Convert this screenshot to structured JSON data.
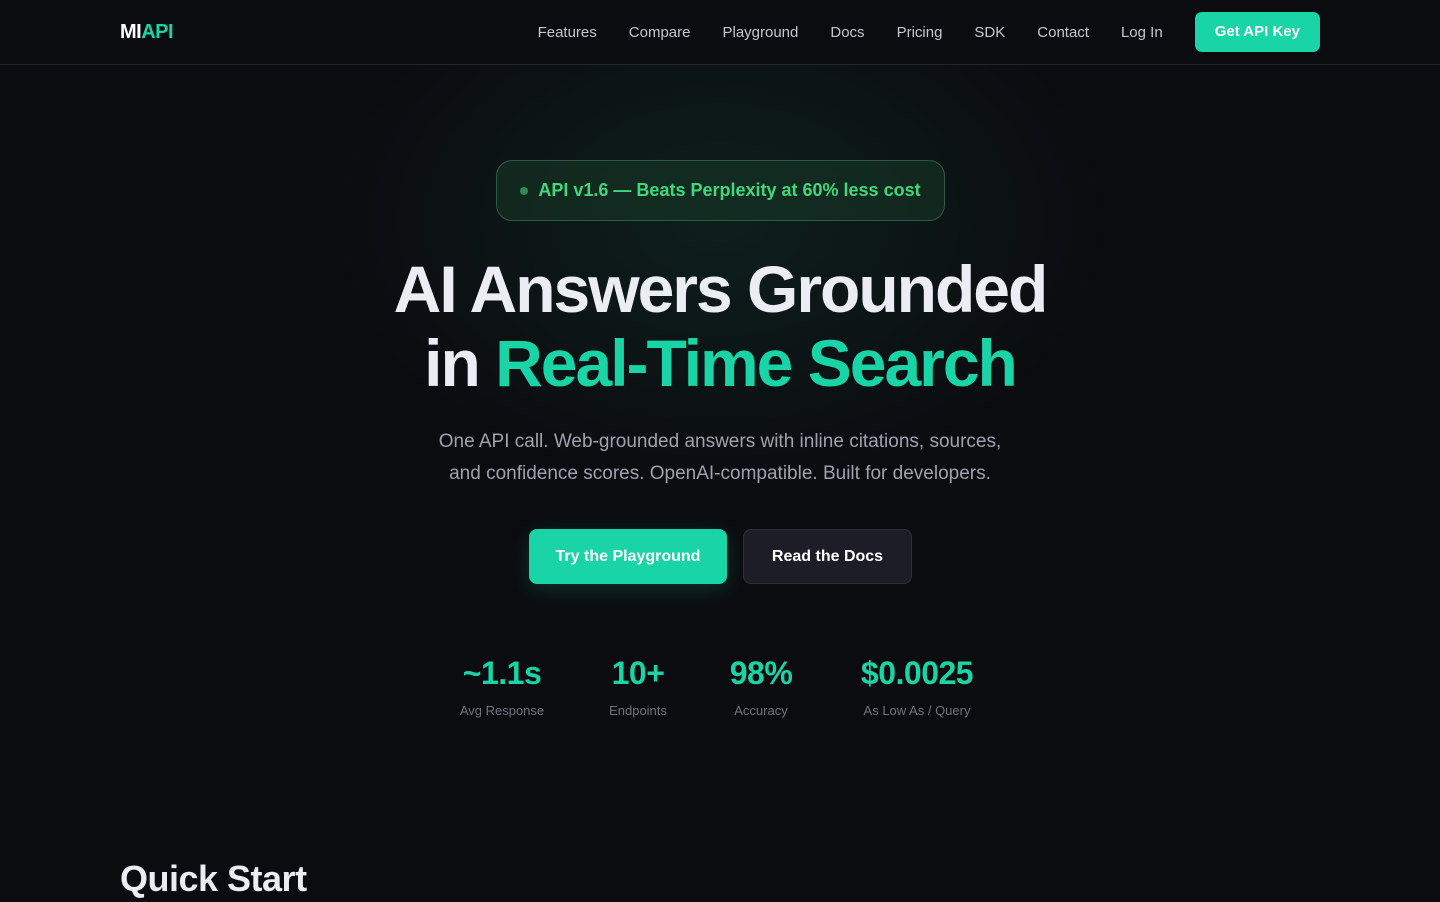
{
  "colors": {
    "background": "#0b0c10",
    "accent": "#19d4a6",
    "badge_text": "#3fd97a",
    "muted_text": "#9ea2ad",
    "secondary_button": "#1c1d26"
  },
  "nav": {
    "logo_primary": "MI",
    "logo_accent": "API",
    "links": [
      "Features",
      "Compare",
      "Playground",
      "Docs",
      "Pricing",
      "SDK",
      "Contact",
      "Log In"
    ],
    "cta": "Get API Key"
  },
  "hero": {
    "badge": "API v1.6 — Beats Perplexity at 60% less cost",
    "headline_line1": "AI Answers Grounded",
    "headline_line2_plain": "in ",
    "headline_line2_accent": "Real-Time Search",
    "subtitle_line1": "One API call. Web-grounded answers with inline citations, sources,",
    "subtitle_line2": "and confidence scores. OpenAI-compatible. Built for developers.",
    "primary_button": "Try the Playground",
    "secondary_button": "Read the Docs"
  },
  "stats": [
    {
      "value": "~1.1s",
      "label": "Avg Response"
    },
    {
      "value": "10+",
      "label": "Endpoints"
    },
    {
      "value": "98%",
      "label": "Accuracy"
    },
    {
      "value": "$0.0025",
      "label": "As Low As / Query"
    }
  ],
  "quick_start": {
    "title": "Quick Start"
  }
}
